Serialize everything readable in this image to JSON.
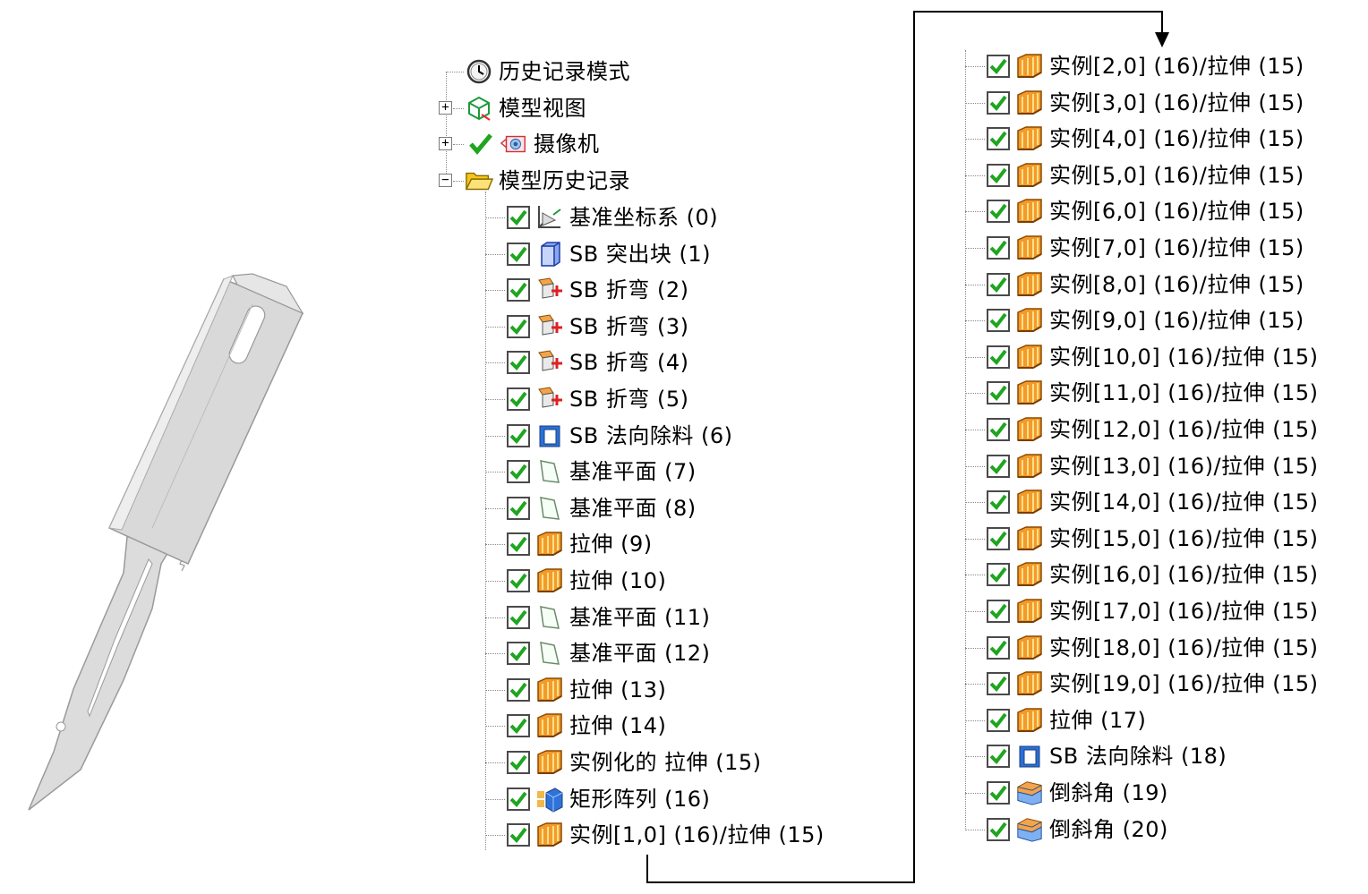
{
  "top_nodes": [
    {
      "label": "历史记录模式",
      "icon": "clock-icon",
      "expander": ""
    },
    {
      "label": "模型视图",
      "icon": "model-view-icon",
      "expander": "+"
    },
    {
      "label": "摄像机",
      "icon": "camera-icon",
      "expander": "+"
    },
    {
      "label": "模型历史记录",
      "icon": "open-folder-icon",
      "expander": "−"
    }
  ],
  "history_left": [
    {
      "label": "基准坐标系 (0)",
      "icon": "datum-csys-icon"
    },
    {
      "label": "SB 突出块 (1)",
      "icon": "tab-block-icon"
    },
    {
      "label": "SB 折弯 (2)",
      "icon": "bend-icon"
    },
    {
      "label": "SB 折弯 (3)",
      "icon": "bend-icon"
    },
    {
      "label": "SB 折弯 (4)",
      "icon": "bend-icon"
    },
    {
      "label": "SB 折弯 (5)",
      "icon": "bend-icon"
    },
    {
      "label": "SB 法向除料 (6)",
      "icon": "normal-cutout-icon"
    },
    {
      "label": "基准平面 (7)",
      "icon": "datum-plane-icon"
    },
    {
      "label": "基准平面 (8)",
      "icon": "datum-plane-icon"
    },
    {
      "label": "拉伸 (9)",
      "icon": "extrude-icon"
    },
    {
      "label": "拉伸 (10)",
      "icon": "extrude-icon"
    },
    {
      "label": "基准平面 (11)",
      "icon": "datum-plane-icon"
    },
    {
      "label": "基准平面 (12)",
      "icon": "datum-plane-icon"
    },
    {
      "label": "拉伸 (13)",
      "icon": "extrude-icon"
    },
    {
      "label": "拉伸 (14)",
      "icon": "extrude-icon"
    },
    {
      "label": "实例化的 拉伸 (15)",
      "icon": "extrude-icon"
    },
    {
      "label": "矩形阵列 (16)",
      "icon": "rect-pattern-icon"
    },
    {
      "label": "实例[1,0] (16)/拉伸 (15)",
      "icon": "extrude-icon"
    }
  ],
  "history_right": [
    {
      "label": "实例[2,0] (16)/拉伸 (15)",
      "icon": "extrude-icon"
    },
    {
      "label": "实例[3,0] (16)/拉伸 (15)",
      "icon": "extrude-icon"
    },
    {
      "label": "实例[4,0] (16)/拉伸 (15)",
      "icon": "extrude-icon"
    },
    {
      "label": "实例[5,0] (16)/拉伸 (15)",
      "icon": "extrude-icon"
    },
    {
      "label": "实例[6,0] (16)/拉伸 (15)",
      "icon": "extrude-icon"
    },
    {
      "label": "实例[7,0] (16)/拉伸 (15)",
      "icon": "extrude-icon"
    },
    {
      "label": "实例[8,0] (16)/拉伸 (15)",
      "icon": "extrude-icon"
    },
    {
      "label": "实例[9,0] (16)/拉伸 (15)",
      "icon": "extrude-icon"
    },
    {
      "label": "实例[10,0] (16)/拉伸 (15)",
      "icon": "extrude-icon"
    },
    {
      "label": "实例[11,0] (16)/拉伸 (15)",
      "icon": "extrude-icon"
    },
    {
      "label": "实例[12,0] (16)/拉伸 (15)",
      "icon": "extrude-icon"
    },
    {
      "label": "实例[13,0] (16)/拉伸 (15)",
      "icon": "extrude-icon"
    },
    {
      "label": "实例[14,0] (16)/拉伸 (15)",
      "icon": "extrude-icon"
    },
    {
      "label": "实例[15,0] (16)/拉伸 (15)",
      "icon": "extrude-icon"
    },
    {
      "label": "实例[16,0] (16)/拉伸 (15)",
      "icon": "extrude-icon"
    },
    {
      "label": "实例[17,0] (16)/拉伸 (15)",
      "icon": "extrude-icon"
    },
    {
      "label": "实例[18,0] (16)/拉伸 (15)",
      "icon": "extrude-icon"
    },
    {
      "label": "实例[19,0] (16)/拉伸 (15)",
      "icon": "extrude-icon"
    },
    {
      "label": "拉伸 (17)",
      "icon": "extrude-icon"
    },
    {
      "label": "SB 法向除料 (18)",
      "icon": "normal-cutout-icon"
    },
    {
      "label": "倒斜角 (19)",
      "icon": "chamfer-icon"
    },
    {
      "label": "倒斜角 (20)",
      "icon": "chamfer-icon"
    }
  ],
  "colors": {
    "check": "#1fa51f",
    "extrude": "#e8921e",
    "part": "#d9d9d9"
  }
}
